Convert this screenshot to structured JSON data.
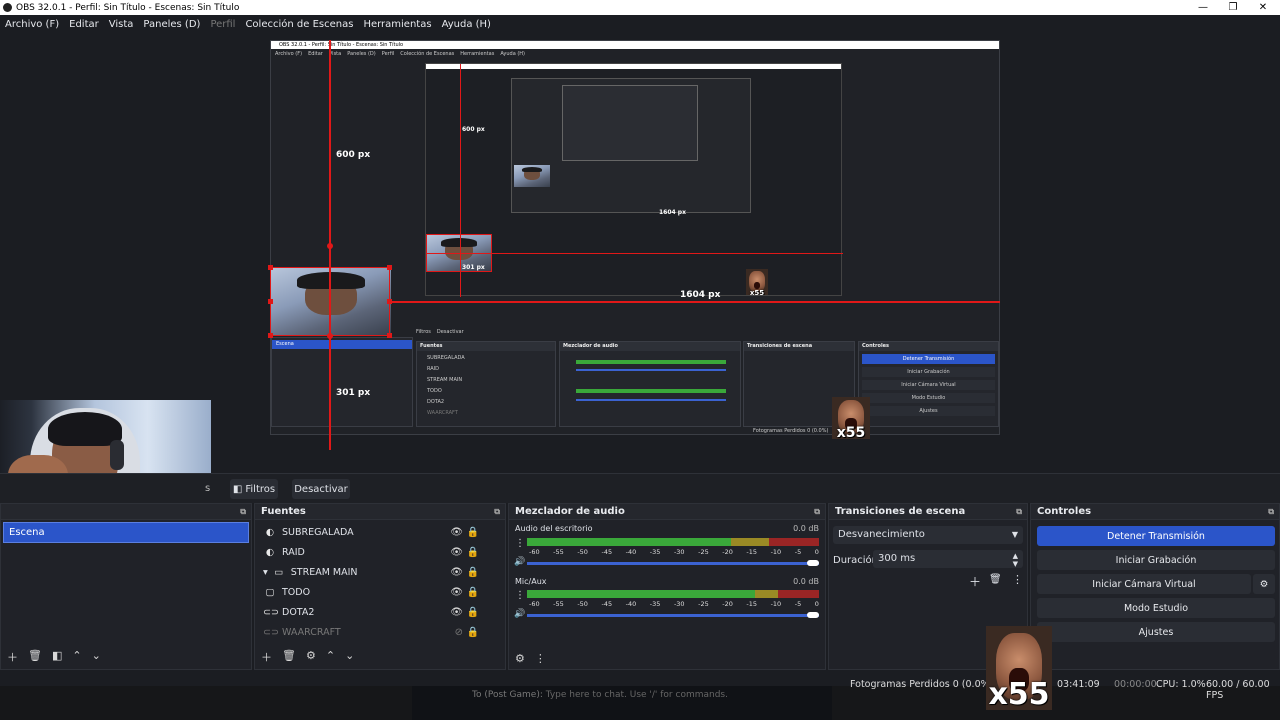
{
  "window": {
    "title": "OBS 32.0.1 - Perfil: Sin Título - Escenas: Sin Título",
    "min": "—",
    "restore": "❐",
    "close": "✕"
  },
  "menu": [
    "Archivo (F)",
    "Editar",
    "Vista",
    "Paneles (D)",
    "Perfil",
    "Colección de Escenas",
    "Herramientas",
    "Ayuda (H)"
  ],
  "preview": {
    "labels": {
      "height_top": "600 px",
      "height_bottom": "301 px",
      "width": "1604 px",
      "nested_top": "600 px",
      "nested_width": "1604 px",
      "nested_bottom": "301 px"
    },
    "inner_title": "OBS 32.0.1 - Perfil: Sin Título - Escenas: Sin Título",
    "inner_menu": [
      "Archivo (F)",
      "Editar",
      "Vista",
      "Paneles (D)",
      "Perfil",
      "Colección de Escenas",
      "Herramientas",
      "Ayuda (H)"
    ],
    "inner_buttons": {
      "filters": "Filtros",
      "deactivate": "Desactivar"
    },
    "inner_panels": {
      "sources": "Fuentes",
      "mixer": "Mezclador de audio",
      "transitions": "Transiciones de escena",
      "controls": "Controles"
    },
    "inner_scene": "Escena",
    "inner_sources": [
      "SUBREGALADA",
      "RAID",
      "STREAM MAIN",
      "TODO",
      "DOTA2",
      "WAARCRAFT"
    ],
    "inner_controls": [
      "Detener Transmisión",
      "Iniciar Grabación",
      "Iniciar Cámara Virtual",
      "Modo Estudio",
      "Ajustes"
    ],
    "inner_status": "Fotogramas Perdidos 0 (0.0%)",
    "meme_text": "x55"
  },
  "toolbar": {
    "filters": "Filtros",
    "deactivate": "Desactivar",
    "partial": "s"
  },
  "scenes": {
    "items": [
      "Escena"
    ]
  },
  "sources": {
    "title": "Fuentes",
    "items": [
      {
        "name": "SUBREGALADA",
        "icon": "◐",
        "disabled": false
      },
      {
        "name": "RAID",
        "icon": "◐",
        "disabled": false
      },
      {
        "name": "STREAM MAIN",
        "icon": "▭",
        "disabled": false,
        "group": true
      },
      {
        "name": "TODO",
        "icon": "▢",
        "disabled": false
      },
      {
        "name": "DOTA2",
        "icon": "⊂⊃",
        "disabled": false
      },
      {
        "name": "WAARCRAFT",
        "icon": "⊂⊃",
        "disabled": true
      }
    ]
  },
  "mixer": {
    "title": "Mezclador de audio",
    "channels": [
      {
        "name": "Audio del escritorio",
        "db": "0.0 dB"
      },
      {
        "name": "Mic/Aux",
        "db": "0.0 dB"
      }
    ],
    "ticks": [
      "-60",
      "-55",
      "-50",
      "-45",
      "-40",
      "-35",
      "-30",
      "-25",
      "-20",
      "-15",
      "-10",
      "-5",
      "0"
    ]
  },
  "transitions": {
    "title": "Transiciones de escena",
    "selected": "Desvanecimiento",
    "duration_label": "Duración",
    "duration_value": "300 ms"
  },
  "controls": {
    "title": "Controles",
    "stop_stream": "Detener Transmisión",
    "start_record": "Iniciar Grabación",
    "start_vcam": "Iniciar Cámara Virtual",
    "studio_mode": "Modo Estudio",
    "settings": "Ajustes"
  },
  "status": {
    "dropped_frames": "Fotogramas Perdidos 0 (0.0%)",
    "stream_time": "03:41:09",
    "rec_time": "00:00:00",
    "cpu": "CPU: 1.0%",
    "fps": "60.00 / 60.00 FPS"
  },
  "chat": {
    "prefix": "To (Post Game):",
    "placeholder": "Type here to chat. Use '/' for commands."
  },
  "meme": {
    "text": "x55"
  },
  "colors": {
    "accent": "#2b55c9",
    "selection": "#e01818",
    "meter_green": "#3aa83a",
    "meter_yellow": "#9a8a25",
    "meter_red": "#9a2525"
  }
}
